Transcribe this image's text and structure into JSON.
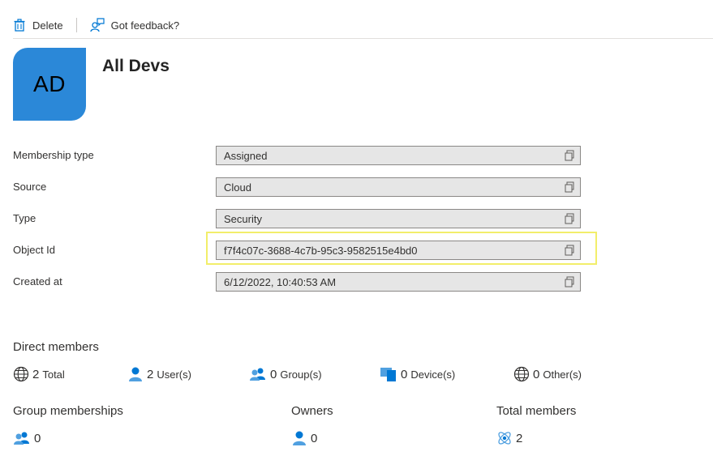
{
  "toolbar": {
    "delete_label": "Delete",
    "feedback_label": "Got feedback?"
  },
  "group": {
    "initials": "AD",
    "name": "All Devs"
  },
  "properties": [
    {
      "label": "Membership type",
      "value": "Assigned"
    },
    {
      "label": "Source",
      "value": "Cloud"
    },
    {
      "label": "Type",
      "value": "Security"
    },
    {
      "label": "Object Id",
      "value": "f7f4c07c-3688-4c7b-95c3-9582515e4bd0"
    },
    {
      "label": "Created at",
      "value": "6/12/2022, 10:40:53 AM"
    }
  ],
  "direct_members": {
    "title": "Direct members",
    "total": {
      "count": "2",
      "label": "Total"
    },
    "users": {
      "count": "2",
      "label": "User(s)"
    },
    "groups": {
      "count": "0",
      "label": "Group(s)"
    },
    "devices": {
      "count": "0",
      "label": "Device(s)"
    },
    "others": {
      "count": "0",
      "label": "Other(s)"
    }
  },
  "group_memberships": {
    "title": "Group memberships",
    "count": "0"
  },
  "owners": {
    "title": "Owners",
    "count": "0"
  },
  "total_members": {
    "title": "Total members",
    "count": "2"
  },
  "colors": {
    "avatar": "#2b88d8",
    "highlight": "#f2ee6a",
    "icon_blue": "#0078d4"
  }
}
